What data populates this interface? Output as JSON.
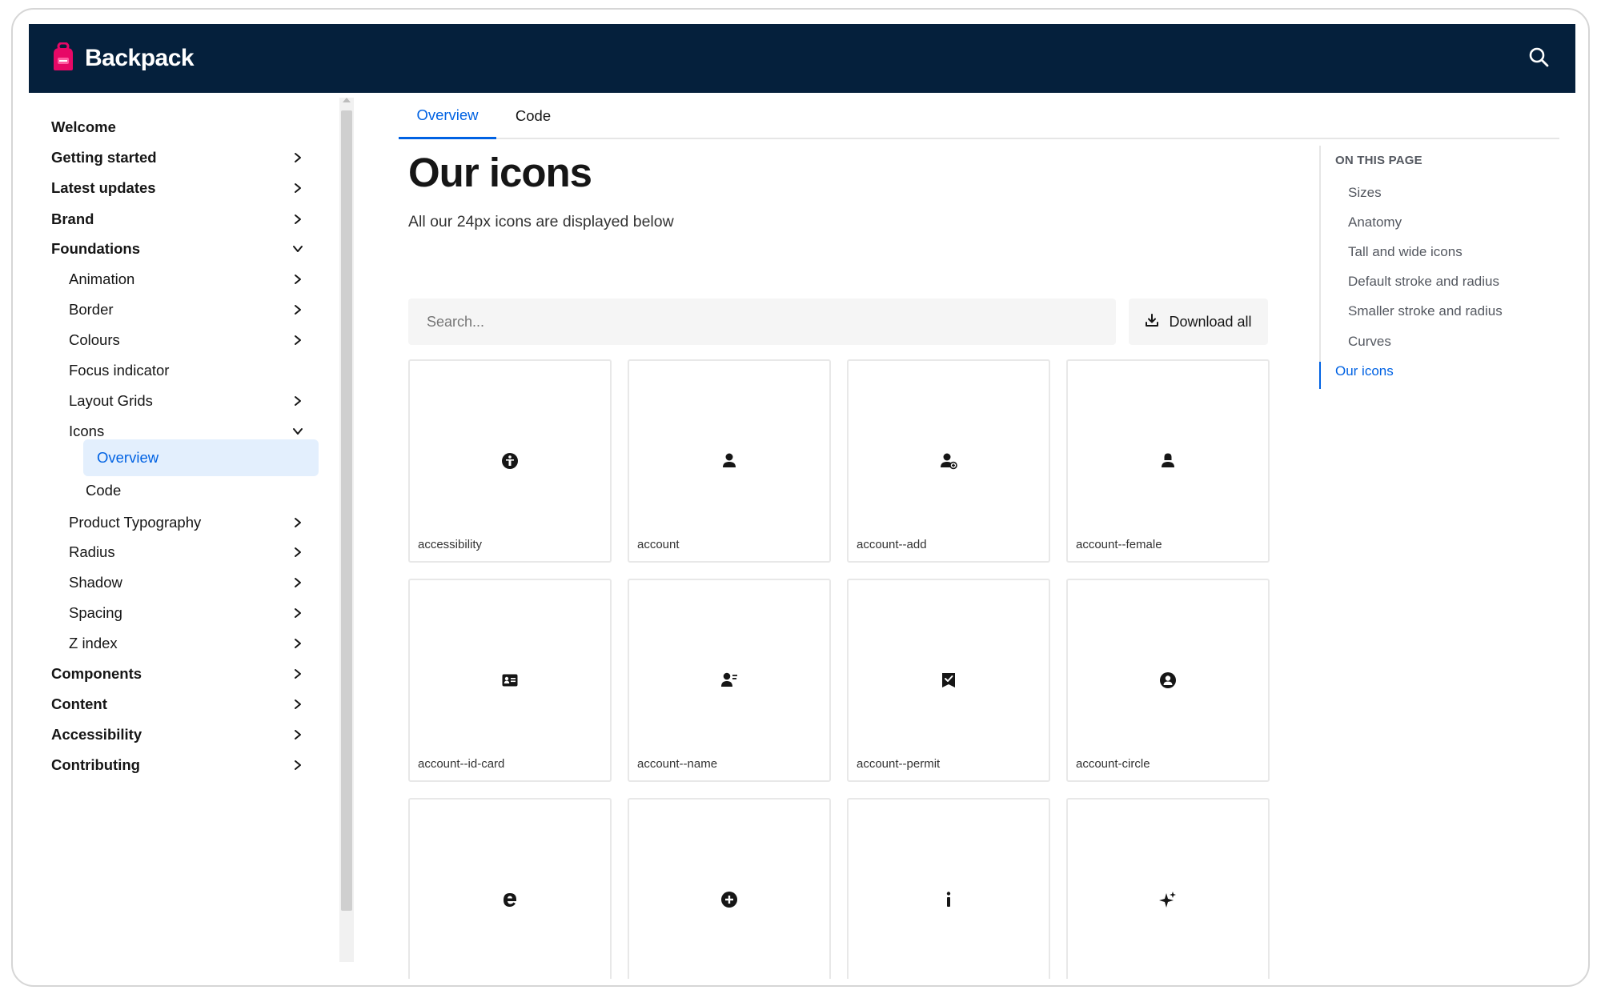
{
  "header": {
    "brand_name": "Backpack",
    "brand_color": "#e70866",
    "bg_color": "#05203c",
    "search_icon": "search-icon"
  },
  "sidebar": {
    "items": [
      {
        "label": "Welcome",
        "level": 0,
        "chevron": "none"
      },
      {
        "label": "Getting started",
        "level": 0,
        "chevron": "right"
      },
      {
        "label": "Latest updates",
        "level": 0,
        "chevron": "right"
      },
      {
        "label": "Brand",
        "level": 0,
        "chevron": "right"
      },
      {
        "label": "Foundations",
        "level": 0,
        "chevron": "down"
      },
      {
        "label": "Animation",
        "level": 1,
        "chevron": "right"
      },
      {
        "label": "Border",
        "level": 1,
        "chevron": "right"
      },
      {
        "label": "Colours",
        "level": 1,
        "chevron": "right"
      },
      {
        "label": "Focus indicator",
        "level": 1,
        "chevron": "none"
      },
      {
        "label": "Layout Grids",
        "level": 1,
        "chevron": "right"
      },
      {
        "label": "Icons",
        "level": 1,
        "chevron": "down"
      },
      {
        "label": "Overview",
        "level": 2,
        "chevron": "none",
        "active": true
      },
      {
        "label": "Code",
        "level": 2,
        "chevron": "none"
      },
      {
        "label": "Product Typography",
        "level": 1,
        "chevron": "right"
      },
      {
        "label": "Radius",
        "level": 1,
        "chevron": "right"
      },
      {
        "label": "Shadow",
        "level": 1,
        "chevron": "right"
      },
      {
        "label": "Spacing",
        "level": 1,
        "chevron": "right"
      },
      {
        "label": "Z index",
        "level": 1,
        "chevron": "right"
      },
      {
        "label": "Components",
        "level": 0,
        "chevron": "right"
      },
      {
        "label": "Content",
        "level": 0,
        "chevron": "right"
      },
      {
        "label": "Accessibility",
        "level": 0,
        "chevron": "right"
      },
      {
        "label": "Contributing",
        "level": 0,
        "chevron": "right"
      }
    ]
  },
  "tabs": [
    {
      "label": "Overview",
      "active": true
    },
    {
      "label": "Code",
      "active": false
    }
  ],
  "main": {
    "title": "Our icons",
    "subtitle": "All our 24px icons are displayed below",
    "search_placeholder": "Search...",
    "download_label": "Download all"
  },
  "icons": [
    {
      "name": "accessibility",
      "icon": "accessibility-icon"
    },
    {
      "name": "account",
      "icon": "account-icon"
    },
    {
      "name": "account--add",
      "icon": "account-add-icon"
    },
    {
      "name": "account--female",
      "icon": "account-female-icon"
    },
    {
      "name": "account--id-card",
      "icon": "account-id-card-icon"
    },
    {
      "name": "account--name",
      "icon": "account-name-icon"
    },
    {
      "name": "account--permit",
      "icon": "account-permit-icon"
    },
    {
      "name": "account-circle",
      "icon": "account-circle-icon"
    },
    {
      "name": "",
      "icon": "e-icon"
    },
    {
      "name": "",
      "icon": "add-circle-icon"
    },
    {
      "name": "",
      "icon": "information-icon"
    },
    {
      "name": "",
      "icon": "sparkle-icon"
    }
  ],
  "toc": {
    "heading": "ON THIS PAGE",
    "items": [
      {
        "label": "Sizes",
        "active": false
      },
      {
        "label": "Anatomy",
        "active": false
      },
      {
        "label": "Tall and wide icons",
        "active": false
      },
      {
        "label": "Default stroke and radius",
        "active": false
      },
      {
        "label": "Smaller stroke and radius",
        "active": false
      },
      {
        "label": "Curves",
        "active": false
      },
      {
        "label": "Our icons",
        "active": true
      }
    ]
  },
  "colors": {
    "accent": "#0062e3",
    "active_bg": "#e3effd",
    "text": "#161616",
    "muted": "#545860"
  }
}
